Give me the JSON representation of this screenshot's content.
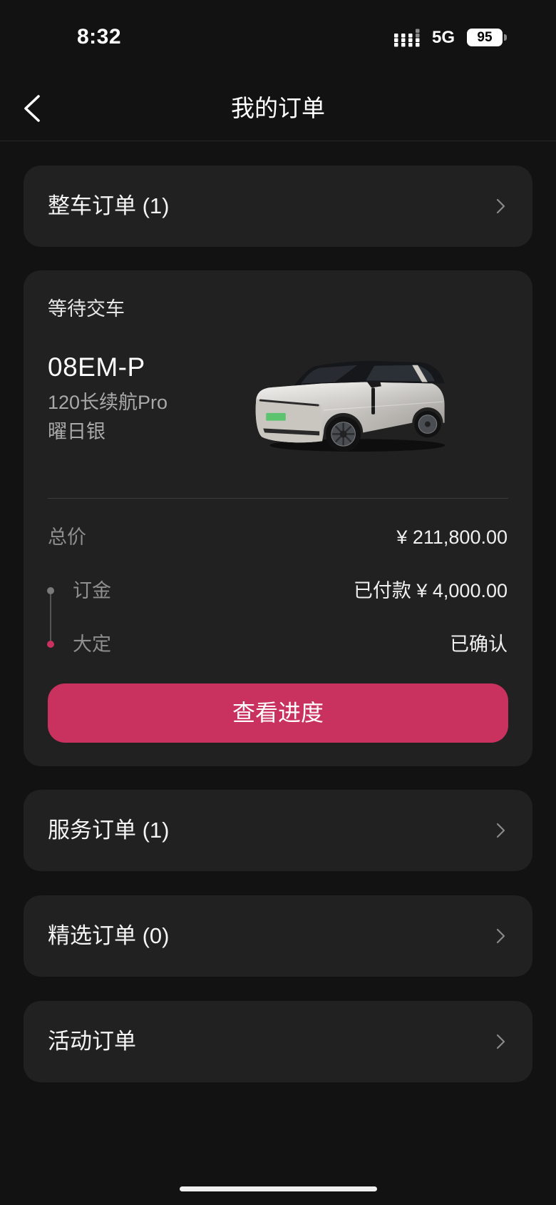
{
  "status_bar": {
    "time": "8:32",
    "network": "5G",
    "battery": "95"
  },
  "header": {
    "title": "我的订单"
  },
  "vehicle_orders": {
    "label": "整车订单 (1)"
  },
  "vehicle_order": {
    "status": "等待交车",
    "model": "08EM-P",
    "trim": "120长续航Pro",
    "color_name": "曜日银",
    "total": {
      "label": "总价",
      "value": "¥ 211,800.00"
    },
    "payments": [
      {
        "label": "订金",
        "value": "已付款 ¥ 4,000.00"
      },
      {
        "label": "大定",
        "value": "已确认"
      }
    ],
    "progress_button": "查看进度"
  },
  "order_sections": [
    {
      "label": "服务订单 (1)"
    },
    {
      "label": "精选订单 (0)"
    },
    {
      "label": "活动订单"
    }
  ],
  "icons": {
    "back": "chevron-left-icon",
    "row_arrow": "chevron-right-icon",
    "signal": "signal-icon",
    "battery": "battery-icon"
  },
  "theme": {
    "background": "#121212",
    "card": "#212121",
    "accent": "#c9315f"
  }
}
